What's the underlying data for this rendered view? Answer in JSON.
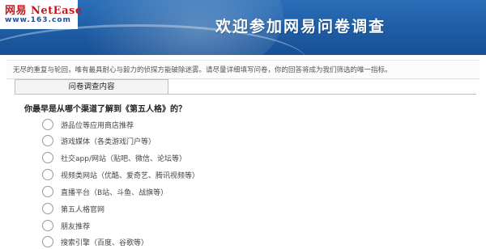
{
  "header": {
    "logo_main": "网易 NetEase",
    "logo_sub": "www.163.com",
    "title": "欢迎参加网易问卷调查"
  },
  "intro": "无尽的重复与轮回，唯有最具耐心与毅力的侦探方能破除迷雾。请尽量详细填写问卷，你的回答将成为我们筛选的唯一指标。",
  "tab": {
    "label": "问卷调查内容"
  },
  "question": {
    "text": "你最早是从哪个渠道了解到《第五人格》的？",
    "options": [
      "游品位等应用商店推荐",
      "游戏媒体（各类游戏门户等）",
      "社交app/网站（贴吧、微信、论坛等）",
      "视频类网站（优酷、爱奇艺、腾讯视频等）",
      "直播平台（B站、斗鱼、战旗等）",
      "第五人格官网",
      "朋友推荐",
      "搜索引擎（百度、谷歌等）"
    ]
  },
  "colors": {
    "banner": "#1f5fa8",
    "logo_red": "#c8161d",
    "logo_blue": "#1f4e9a"
  }
}
